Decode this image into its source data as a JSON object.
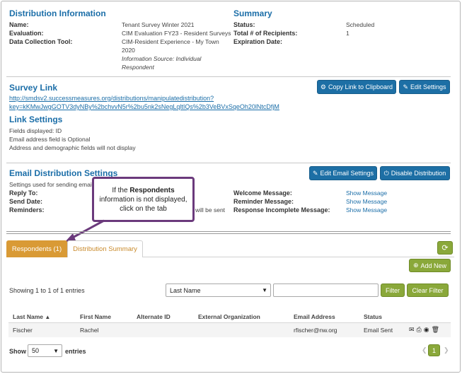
{
  "distribution_info": {
    "heading": "Distribution Information",
    "name_label": "Name:",
    "name_value": "Tenant Survey Winter 2021",
    "evaluation_label": "Evaluation:",
    "evaluation_value": "CIM Evaluation FY23 - Resident Surveys",
    "tool_label": "Data Collection Tool:",
    "tool_value_line1": "CIM-Resident Experience - My Town",
    "tool_value_line2": "2020",
    "tool_source_line1": "Information Source: Individual",
    "tool_source_line2": "Respondent"
  },
  "summary": {
    "heading": "Summary",
    "status_label": "Status:",
    "status_value": "Scheduled",
    "recipients_label": "Total # of Recipients:",
    "recipients_value": "1",
    "expiration_label": "Expiration Date:"
  },
  "survey_link": {
    "heading": "Survey Link",
    "url_line1": "http://smdsv2.successmeasures.org/distributions/manipulatedistribution?",
    "url_line2": "key=kKMwJwgGOTV3dyNBy%2bchvvN5r%2bu5nk2sNegLqltIQs%2b3VeBVxSqeOh20lNtcDfjM",
    "copy_button": "Copy Link to Clipboard",
    "edit_button": "Edit Settings"
  },
  "link_settings": {
    "heading": "Link Settings",
    "line1": "Fields displayed: ID",
    "line2": "Email address field is Optional",
    "line3": "Address and demographic fields will not display"
  },
  "email_settings": {
    "heading": "Email Distribution Settings",
    "edit_button": "Edit Email Settings",
    "disable_button": "Disable Distribution",
    "subtext": "Settings used for sending emails",
    "reply_label": "Reply To:",
    "send_label": "Send Date:",
    "reminders_label": "Reminders:",
    "reminders_value_tail": "will be sent",
    "welcome_label": "Welcome Message:",
    "reminder_msg_label": "Reminder Message:",
    "incomplete_label": "Response Incomplete Message:",
    "show_message": "Show Message"
  },
  "callout": {
    "prefix": "If the ",
    "bold": "Respondents",
    "suffix": " information is not displayed, click on the tab"
  },
  "tabs": {
    "respondents": "Respondents (1)",
    "summary": "Distribution Summary"
  },
  "toolbar": {
    "add_new": "Add New",
    "showing": "Showing 1 to 1 of 1 entries",
    "filter_select": "Last Name",
    "filter_button": "Filter",
    "clear_button": "Clear Filter"
  },
  "table": {
    "headers": [
      "Last Name",
      "First Name",
      "Alternate ID",
      "External Organization",
      "Email Address",
      "Status"
    ],
    "rows": [
      [
        "Fischer",
        "Rachel",
        "",
        "",
        "rfischer@nw.org",
        "Email Sent"
      ]
    ]
  },
  "footer": {
    "show_label": "Show",
    "page_size": "50",
    "entries_label": "entries",
    "page_number": "1"
  },
  "colors": {
    "heading_blue": "#1b6ea8",
    "button_blue": "#1d6fa5",
    "button_green": "#8aa83a",
    "tab_active": "#d99a35",
    "callout_border": "#6b3a7c"
  }
}
